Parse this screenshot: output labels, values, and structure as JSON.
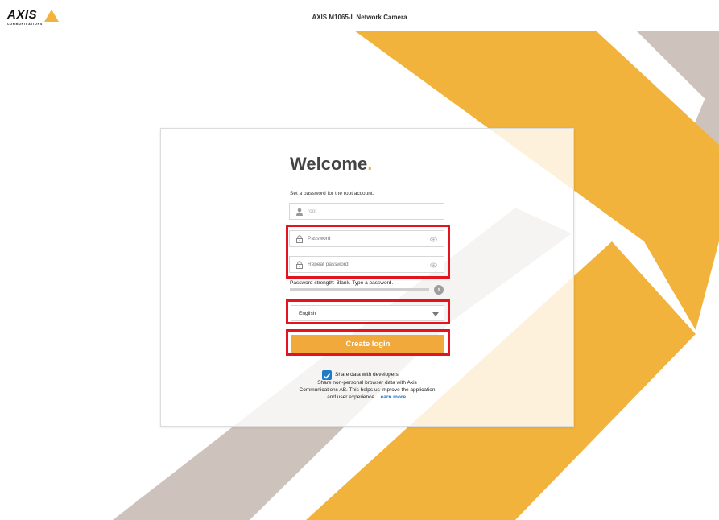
{
  "header": {
    "logo_text": "AXIS",
    "logo_sub": "COMMUNICATIONS",
    "title": "AXIS M1065-L Network Camera"
  },
  "form": {
    "welcome": "Welcome",
    "welcome_dot": ".",
    "subtitle": "Set a password for the root account.",
    "username_placeholder": "root",
    "password_placeholder": "Password",
    "repeat_password_placeholder": "Repeat password",
    "strength_text": "Password strength: Blank. Type a password.",
    "info_glyph": "i",
    "language_selected": "English",
    "create_login_label": "Create login",
    "share_label": "Share data with developers",
    "share_desc": "Share non-personal browser data with Axis Communications AB. This helps us improve the application and user experience.",
    "learn_more": "Learn more."
  },
  "icons": {
    "user": "user-icon",
    "lock": "lock-icon",
    "eye": "eye-icon",
    "info": "info-icon",
    "dropdown": "chevron-down-icon",
    "check": "checkmark-icon"
  },
  "colors": {
    "accent": "#f2b33d",
    "button": "#f0a93a",
    "highlight": "#e3141e",
    "link": "#1e7bc8",
    "stripe_gray": "#cdc3bc"
  }
}
